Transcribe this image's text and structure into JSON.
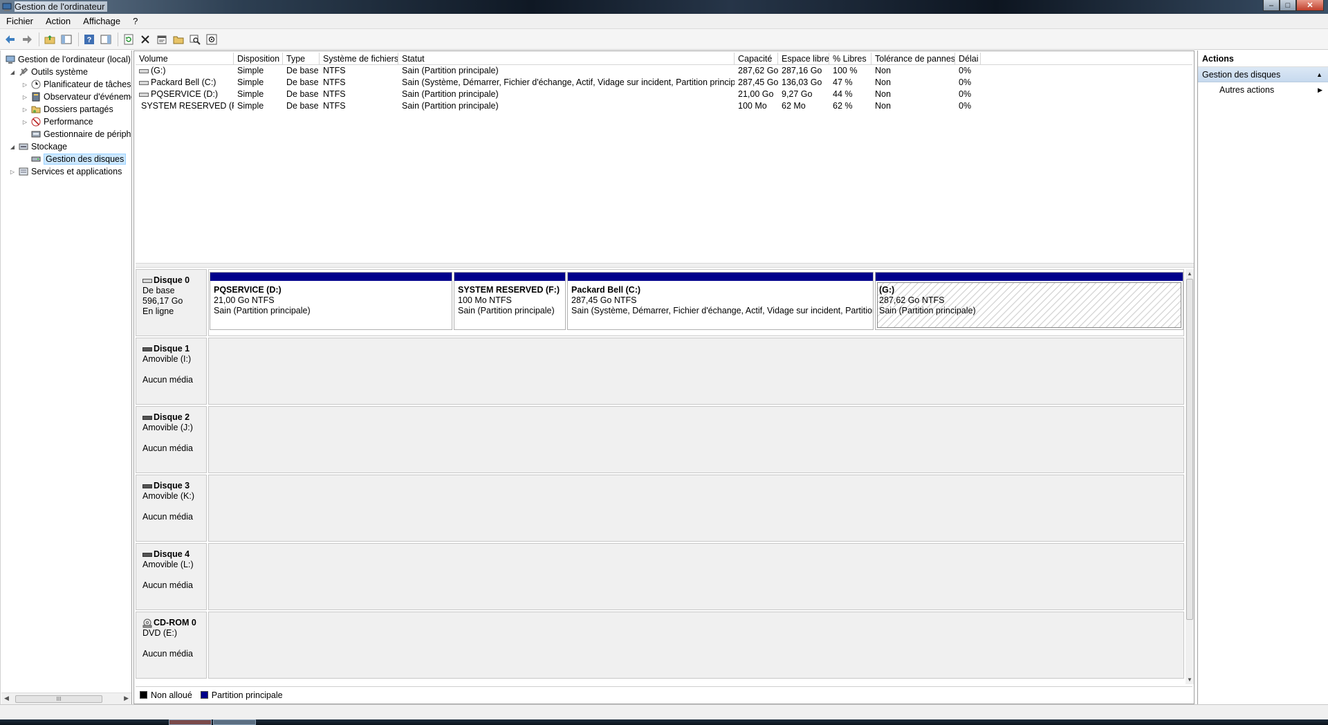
{
  "window": {
    "title": "Gestion de l'ordinateur",
    "buttons": {
      "minimize": "–",
      "maximize": "□",
      "close": "✕"
    }
  },
  "menubar": {
    "items": [
      "Fichier",
      "Action",
      "Affichage",
      "?"
    ]
  },
  "toolbar": {
    "icons": [
      "back-icon",
      "forward-icon",
      "up-folder-icon",
      "show-hide-tree-icon",
      "help-icon",
      "show-hide-action-pane-icon",
      "refresh-icon",
      "delete-icon",
      "properties-icon",
      "open-icon",
      "search-icon",
      "settings-icon"
    ]
  },
  "tree": {
    "root": "Gestion de l'ordinateur (local)",
    "outils": "Outils système",
    "planificateur": "Planificateur de tâches",
    "observateur": "Observateur d'événeme",
    "dossiers": "Dossiers partagés",
    "performance": "Performance",
    "gestionnaire": "Gestionnaire de périphé",
    "stockage": "Stockage",
    "gestion_disques": "Gestion des disques",
    "services": "Services et applications",
    "scroll_grip": "III"
  },
  "volumes": {
    "headers": {
      "volume": "Volume",
      "disposition": "Disposition",
      "type": "Type",
      "fs": "Système de fichiers",
      "statut": "Statut",
      "capacite": "Capacité",
      "espace": "Espace libre",
      "pct": "% Libres",
      "tolerance": "Tolérance de pannes",
      "delai": "Délai"
    },
    "rows": [
      {
        "volume": "(G:)",
        "disposition": "Simple",
        "type": "De base",
        "fs": "NTFS",
        "statut": "Sain (Partition principale)",
        "capacite": "287,62 Go",
        "espace": "287,16 Go",
        "pct": "100 %",
        "tolerance": "Non",
        "delai": "0%"
      },
      {
        "volume": "Packard Bell (C:)",
        "disposition": "Simple",
        "type": "De base",
        "fs": "NTFS",
        "statut": "Sain (Système, Démarrer, Fichier d'échange, Actif, Vidage sur incident, Partition principale)",
        "capacite": "287,45 Go",
        "espace": "136,03 Go",
        "pct": "47 %",
        "tolerance": "Non",
        "delai": "0%"
      },
      {
        "volume": "PQSERVICE (D:)",
        "disposition": "Simple",
        "type": "De base",
        "fs": "NTFS",
        "statut": "Sain (Partition principale)",
        "capacite": "21,00 Go",
        "espace": "9,27 Go",
        "pct": "44 %",
        "tolerance": "Non",
        "delai": "0%"
      },
      {
        "volume": "SYSTEM RESERVED (F:)",
        "disposition": "Simple",
        "type": "De base",
        "fs": "NTFS",
        "statut": "Sain (Partition principale)",
        "capacite": "100 Mo",
        "espace": "62 Mo",
        "pct": "62 %",
        "tolerance": "Non",
        "delai": "0%"
      }
    ]
  },
  "disks": {
    "disk0": {
      "name": "Disque 0",
      "kind": "De base",
      "size": "596,17 Go",
      "state": "En ligne",
      "partitions": [
        {
          "name": "PQSERVICE  (D:)",
          "size": "21,00 Go NTFS",
          "status": "Sain (Partition principale)"
        },
        {
          "name": "SYSTEM RESERVED  (F:)",
          "size": "100 Mo NTFS",
          "status": "Sain (Partition principale)"
        },
        {
          "name": "Packard Bell  (C:)",
          "size": "287,45 Go NTFS",
          "status": "Sain (Système, Démarrer, Fichier d'échange, Actif, Vidage sur incident, Partition pr"
        },
        {
          "name": "(G:)",
          "size": "287,62 Go NTFS",
          "status": "Sain (Partition principale)"
        }
      ]
    },
    "disk1": {
      "name": "Disque 1",
      "kind": "Amovible (I:)",
      "media": "Aucun média"
    },
    "disk2": {
      "name": "Disque 2",
      "kind": "Amovible (J:)",
      "media": "Aucun média"
    },
    "disk3": {
      "name": "Disque 3",
      "kind": "Amovible (K:)",
      "media": "Aucun média"
    },
    "disk4": {
      "name": "Disque 4",
      "kind": "Amovible (L:)",
      "media": "Aucun média"
    },
    "cdrom0": {
      "name": "CD-ROM 0",
      "kind": "DVD (E:)",
      "media": "Aucun média"
    }
  },
  "legend": {
    "unallocated": "Non alloué",
    "primary": "Partition principale",
    "colors": {
      "unallocated": "#000000",
      "primary": "#00008b"
    }
  },
  "actions": {
    "title": "Actions",
    "section": "Gestion des disques",
    "more": "Autres actions"
  },
  "colors": {
    "partition_bar": "#00008b",
    "selection": "#cce8ff",
    "actions_header": "#c6d9ee"
  }
}
